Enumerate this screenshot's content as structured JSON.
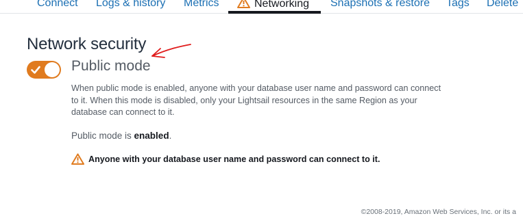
{
  "tabs": [
    {
      "label": "Connect"
    },
    {
      "label": "Logs & history"
    },
    {
      "label": "Metrics"
    },
    {
      "label": "Networking",
      "active": true,
      "icon": "warning-icon"
    },
    {
      "label": "Snapshots & restore"
    },
    {
      "label": "Tags"
    },
    {
      "label": "Delete"
    }
  ],
  "section": {
    "title": "Network security",
    "toggle_label": "Public mode",
    "toggle_on": true,
    "description": "When public mode is enabled, anyone with your database user name and password can connect to it. When this mode is disabled, only your Lightsail resources in the same Region as your database can connect to it.",
    "status_prefix": "Public mode is ",
    "status_value": "enabled",
    "status_suffix": ".",
    "warning_text": "Anyone with your database user name and password can connect to it."
  },
  "footer": {
    "copyright": "©2008-2019, Amazon Web Services, Inc. or its a"
  },
  "colors": {
    "accent_orange": "#e07b1f",
    "link_blue": "#1b6fb3",
    "annotation_red": "#e01b1b"
  }
}
